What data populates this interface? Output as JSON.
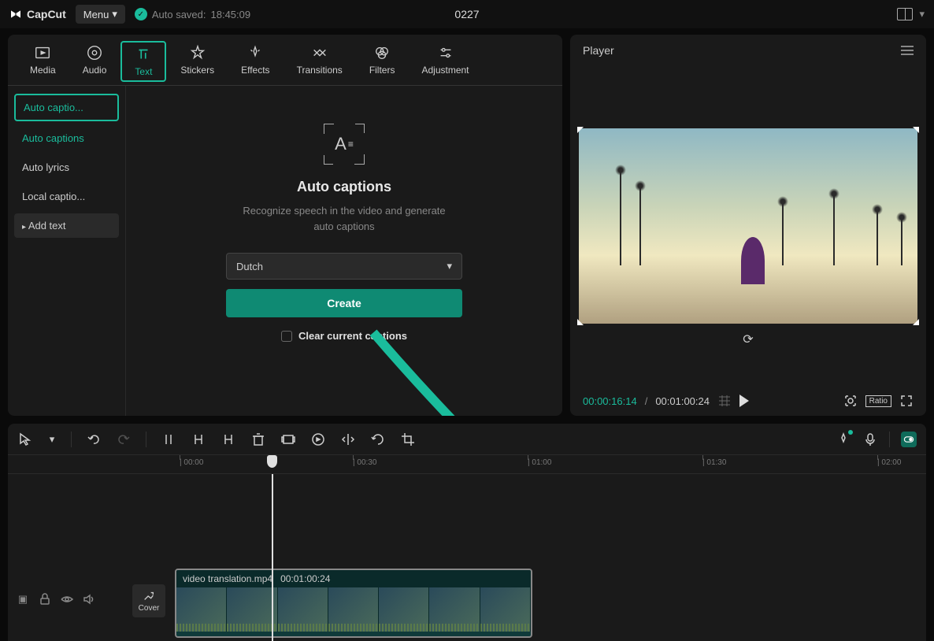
{
  "app": {
    "name": "CapCut",
    "menu_label": "Menu",
    "autosave_label": "Auto saved:",
    "autosave_time": "18:45:09",
    "project_name": "0227"
  },
  "tabs": [
    {
      "label": "Media"
    },
    {
      "label": "Audio"
    },
    {
      "label": "Text"
    },
    {
      "label": "Stickers"
    },
    {
      "label": "Effects"
    },
    {
      "label": "Transitions"
    },
    {
      "label": "Filters"
    },
    {
      "label": "Adjustment"
    }
  ],
  "sidebar": {
    "items": [
      {
        "label": "Auto captio..."
      },
      {
        "label": "Auto captions"
      },
      {
        "label": "Auto lyrics"
      },
      {
        "label": "Local captio..."
      },
      {
        "label": "Add text"
      }
    ]
  },
  "autocaptions": {
    "title": "Auto captions",
    "description": "Recognize speech in the video and generate auto captions",
    "language": "Dutch",
    "create_label": "Create",
    "clear_label": "Clear current captions"
  },
  "player": {
    "title": "Player",
    "time_current": "00:00:16:14",
    "time_total": "00:01:00:24",
    "ratio_label": "Ratio"
  },
  "ruler": [
    "00:00",
    "00:30",
    "01:00",
    "01:30",
    "02:00"
  ],
  "clip": {
    "name": "video translation.mp4",
    "duration": "00:01:00:24"
  },
  "cover_label": "Cover"
}
